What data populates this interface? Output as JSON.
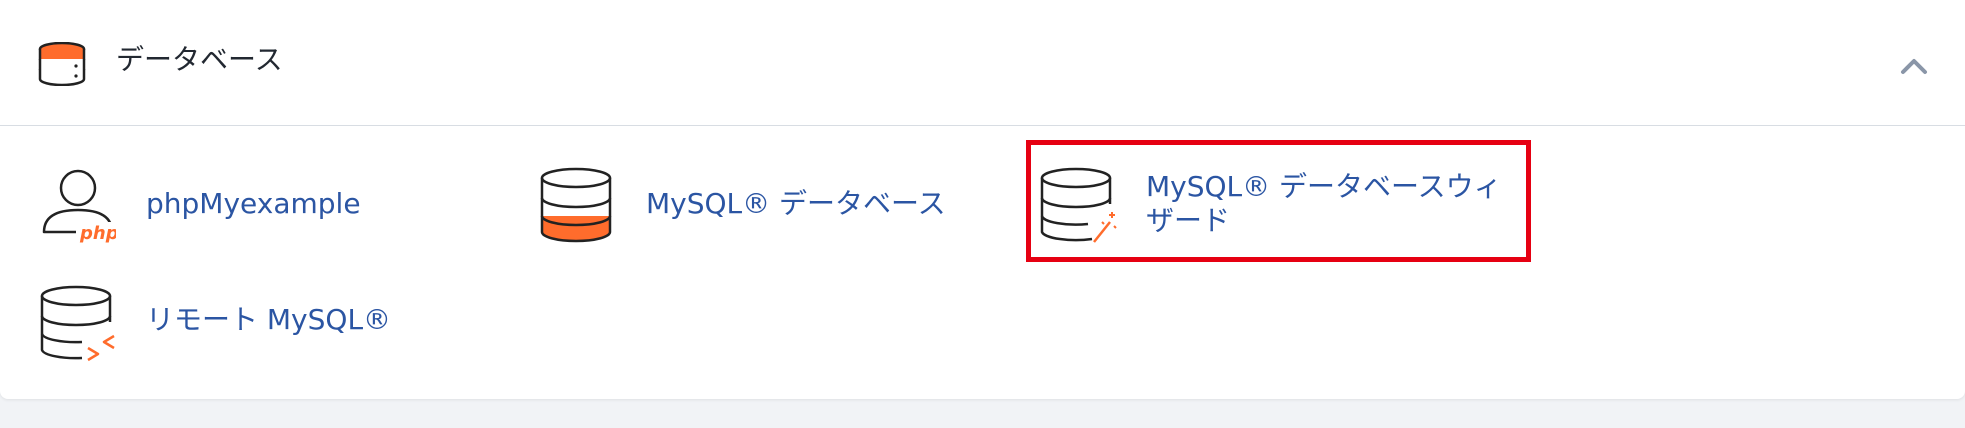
{
  "section": {
    "title": "データベース",
    "header_icon": "database-stack-icon",
    "collapse_icon": "chevron-up-icon"
  },
  "tools": [
    {
      "id": "phpmyadmin",
      "label": "phpMyexample",
      "icon": "php-user-icon",
      "badge": "php"
    },
    {
      "id": "mysql-databases",
      "label": "MySQL® データベース",
      "icon": "database-icon"
    },
    {
      "id": "mysql-wizard",
      "label": "MySQL® データベースウィザード",
      "icon": "database-wizard-icon",
      "highlighted": true
    },
    {
      "id": "remote-mysql",
      "label": "リモート MySQL®",
      "icon": "remote-database-icon"
    }
  ],
  "colors": {
    "accent_orange": "#ff6c2c",
    "link_blue": "#2b55a3",
    "highlight_red": "#e60012",
    "border": "#d8dde3"
  }
}
